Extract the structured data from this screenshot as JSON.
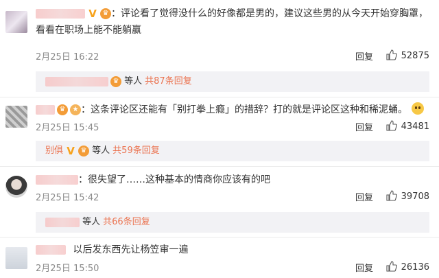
{
  "comments": [
    {
      "text": "：评论看了觉得没什么的好像都是男的，建议这些男的从今天开始穿胸罩，看看在职场上能不能躺赢",
      "date": "2月25日 16:22",
      "reply_label": "回复",
      "likes": "52875",
      "sub_summary_mid": "等人",
      "sub_summary_more": "共87条回复"
    },
    {
      "text": "：这条评论区还能有「别打拳上瘾」的措辞？打的就是评论区这种和稀泥蛹。",
      "date": "2月25日 15:45",
      "reply_label": "回复",
      "likes": "43481",
      "sub_user": "别俱",
      "sub_summary_mid": "等人",
      "sub_summary_more": "共59条回复"
    },
    {
      "text": "：很失望了……这种基本的情商你应该有的吧",
      "date": "2月25日 15:42",
      "reply_label": "回复",
      "likes": "39708",
      "sub_summary_mid": "等人",
      "sub_summary_more": "共66条回复"
    },
    {
      "text": "以后发东西先让杨笠审一遍",
      "date": "2月25日 15:50",
      "reply_label": "回复",
      "likes": "26136"
    }
  ],
  "colors": {
    "link": "#eb7350",
    "meta": "#8a8a8a",
    "sub_bg": "#f2f2f5"
  }
}
